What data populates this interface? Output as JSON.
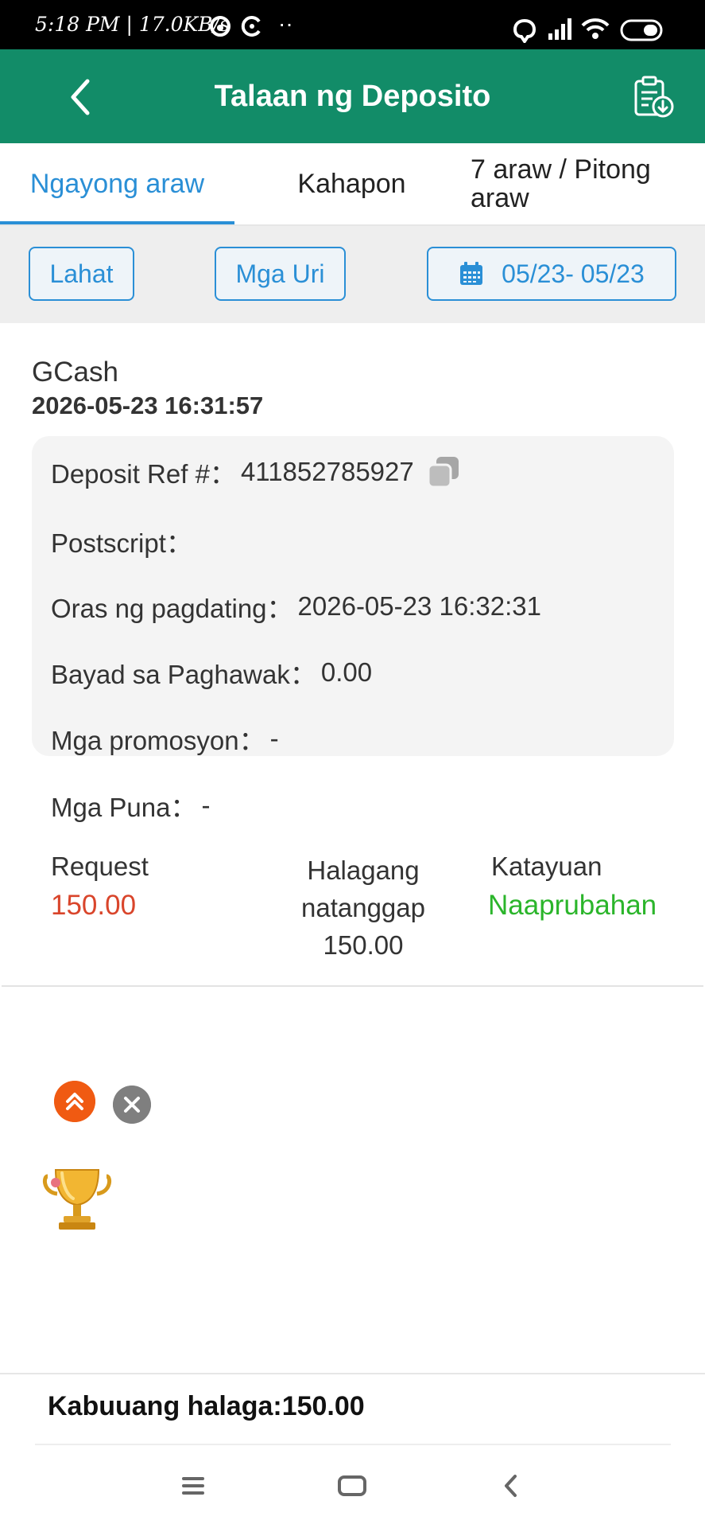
{
  "status_bar": {
    "time_speed": "5:18 PM | 17.0KB/s",
    "dots": "··"
  },
  "header": {
    "title": "Talaan ng Deposito",
    "back_icon": "chevron-left-icon",
    "export_icon": "clipboard-download-icon",
    "color": "#128c68"
  },
  "tabs": {
    "today": "Ngayong araw",
    "yesterday": "Kahapon",
    "seven_days": "7 araw / Pitong araw",
    "active": "today",
    "active_color": "#2a8fd6"
  },
  "filters": {
    "all": "Lahat",
    "types": "Mga Uri",
    "date_range": "05/23- 05/23"
  },
  "record": {
    "method": "GCash",
    "created_at": "2026-05-23 16:31:57",
    "details": {
      "ref_label": "Deposit Ref #：",
      "ref_value": "411852785927",
      "postscript_label": "Postscript：",
      "postscript_value": "",
      "arrival_label": "Oras ng pagdating：",
      "arrival_value": "2026-05-23 16:32:31",
      "fee_label": "Bayad sa Paghawak：",
      "fee_value": "0.00",
      "promo_label": "Mga promosyon：",
      "promo_value": "-",
      "remarks_label": "Mga Puna：",
      "remarks_value": "-"
    },
    "summary": {
      "request_label": "Request",
      "request_value": "150.00",
      "received_label_1": "Halagang",
      "received_label_2": "natanggap",
      "received_value": "150.00",
      "status_label": "Katayuan",
      "status_value": "Naaprubahan",
      "request_color": "#d9452b",
      "status_color": "#2bb52b"
    }
  },
  "footer": {
    "total": "Kabuuang halaga:150.00"
  }
}
